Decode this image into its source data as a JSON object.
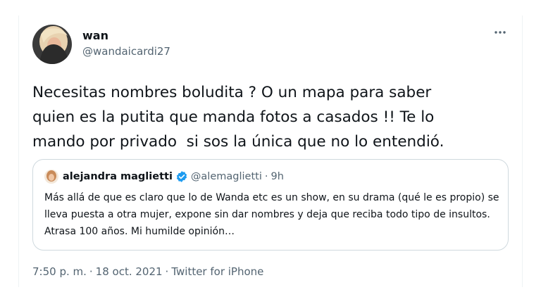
{
  "author": {
    "name": "wan",
    "handle": "@wandaicardi27"
  },
  "tweet": {
    "text": "Necesitas nombres boludita ? O un mapa para saber\nquien es la putita que manda fotos a casados !! Te lo\nmando por privado  si sos la única que no lo entendió."
  },
  "quote": {
    "name": "alejandra maglietti",
    "handle": "@alemaglietti",
    "separator": "·",
    "time": "9h",
    "text": "Más allá de que es claro que lo de Wanda etc es un show, en su drama (qué le es propio) se lleva puesta a otra mujer, expone sin dar nombres y deja que reciba todo tipo de insultos. Atrasa 100 años. Mi humilde opinión…"
  },
  "meta": {
    "time": "7:50 p. m.",
    "date": "18 oct. 2021",
    "source": "Twitter for iPhone",
    "separator": "·"
  },
  "icons": {
    "more": "more-horizontal-icon",
    "verified": "verified-badge-icon"
  },
  "colors": {
    "verified": "#1d9bf0",
    "secondary_text": "#536471",
    "primary_text": "#0f1419",
    "border": "#cfd9de"
  }
}
